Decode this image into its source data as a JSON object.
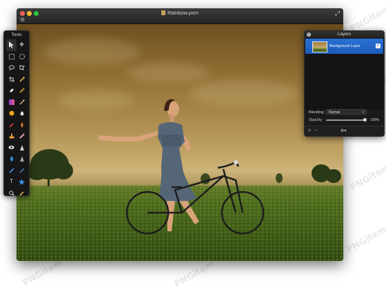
{
  "window": {
    "title": "Rainbow.pxm",
    "document_icon": "pxm-document-icon",
    "gear_icon": "gear-icon",
    "fullscreen_icon": "fullscreen-arrows-icon"
  },
  "tools_panel": {
    "title": "Tools",
    "tools": [
      "select-icon",
      "move-icon",
      "rect-select-icon",
      "ellipse-select-icon",
      "lasso-icon",
      "polygon-lasso-icon",
      "crop-icon",
      "eyedropper-icon",
      "eraser-icon",
      "pencil-icon",
      "gradient-icon",
      "brush-icon",
      "fill-icon",
      "smudge-icon",
      "red-eye-icon",
      "burn-icon",
      "stamp-icon",
      "heal-icon",
      "eye-icon",
      "sharpen-icon",
      "drop-icon",
      "sponge-icon",
      "pen-icon",
      "line-icon",
      "text-icon",
      "shape-star-icon",
      "zoom-icon",
      "color-picker-icon"
    ]
  },
  "layers_panel": {
    "title": "Layers",
    "layer_name": "Background Layer",
    "blending_label": "Blending:",
    "blending_value": "Normal",
    "opacity_label": "Opacity:",
    "opacity_value": "100%",
    "opacity_fraction": 1.0,
    "add_label": "+",
    "remove_label": "−",
    "gear_label": "⚙▾"
  },
  "colors": {
    "selection_blue": "#1c5cb7",
    "panel_bg": "#1a1a1a"
  },
  "watermark": "PNGitem"
}
